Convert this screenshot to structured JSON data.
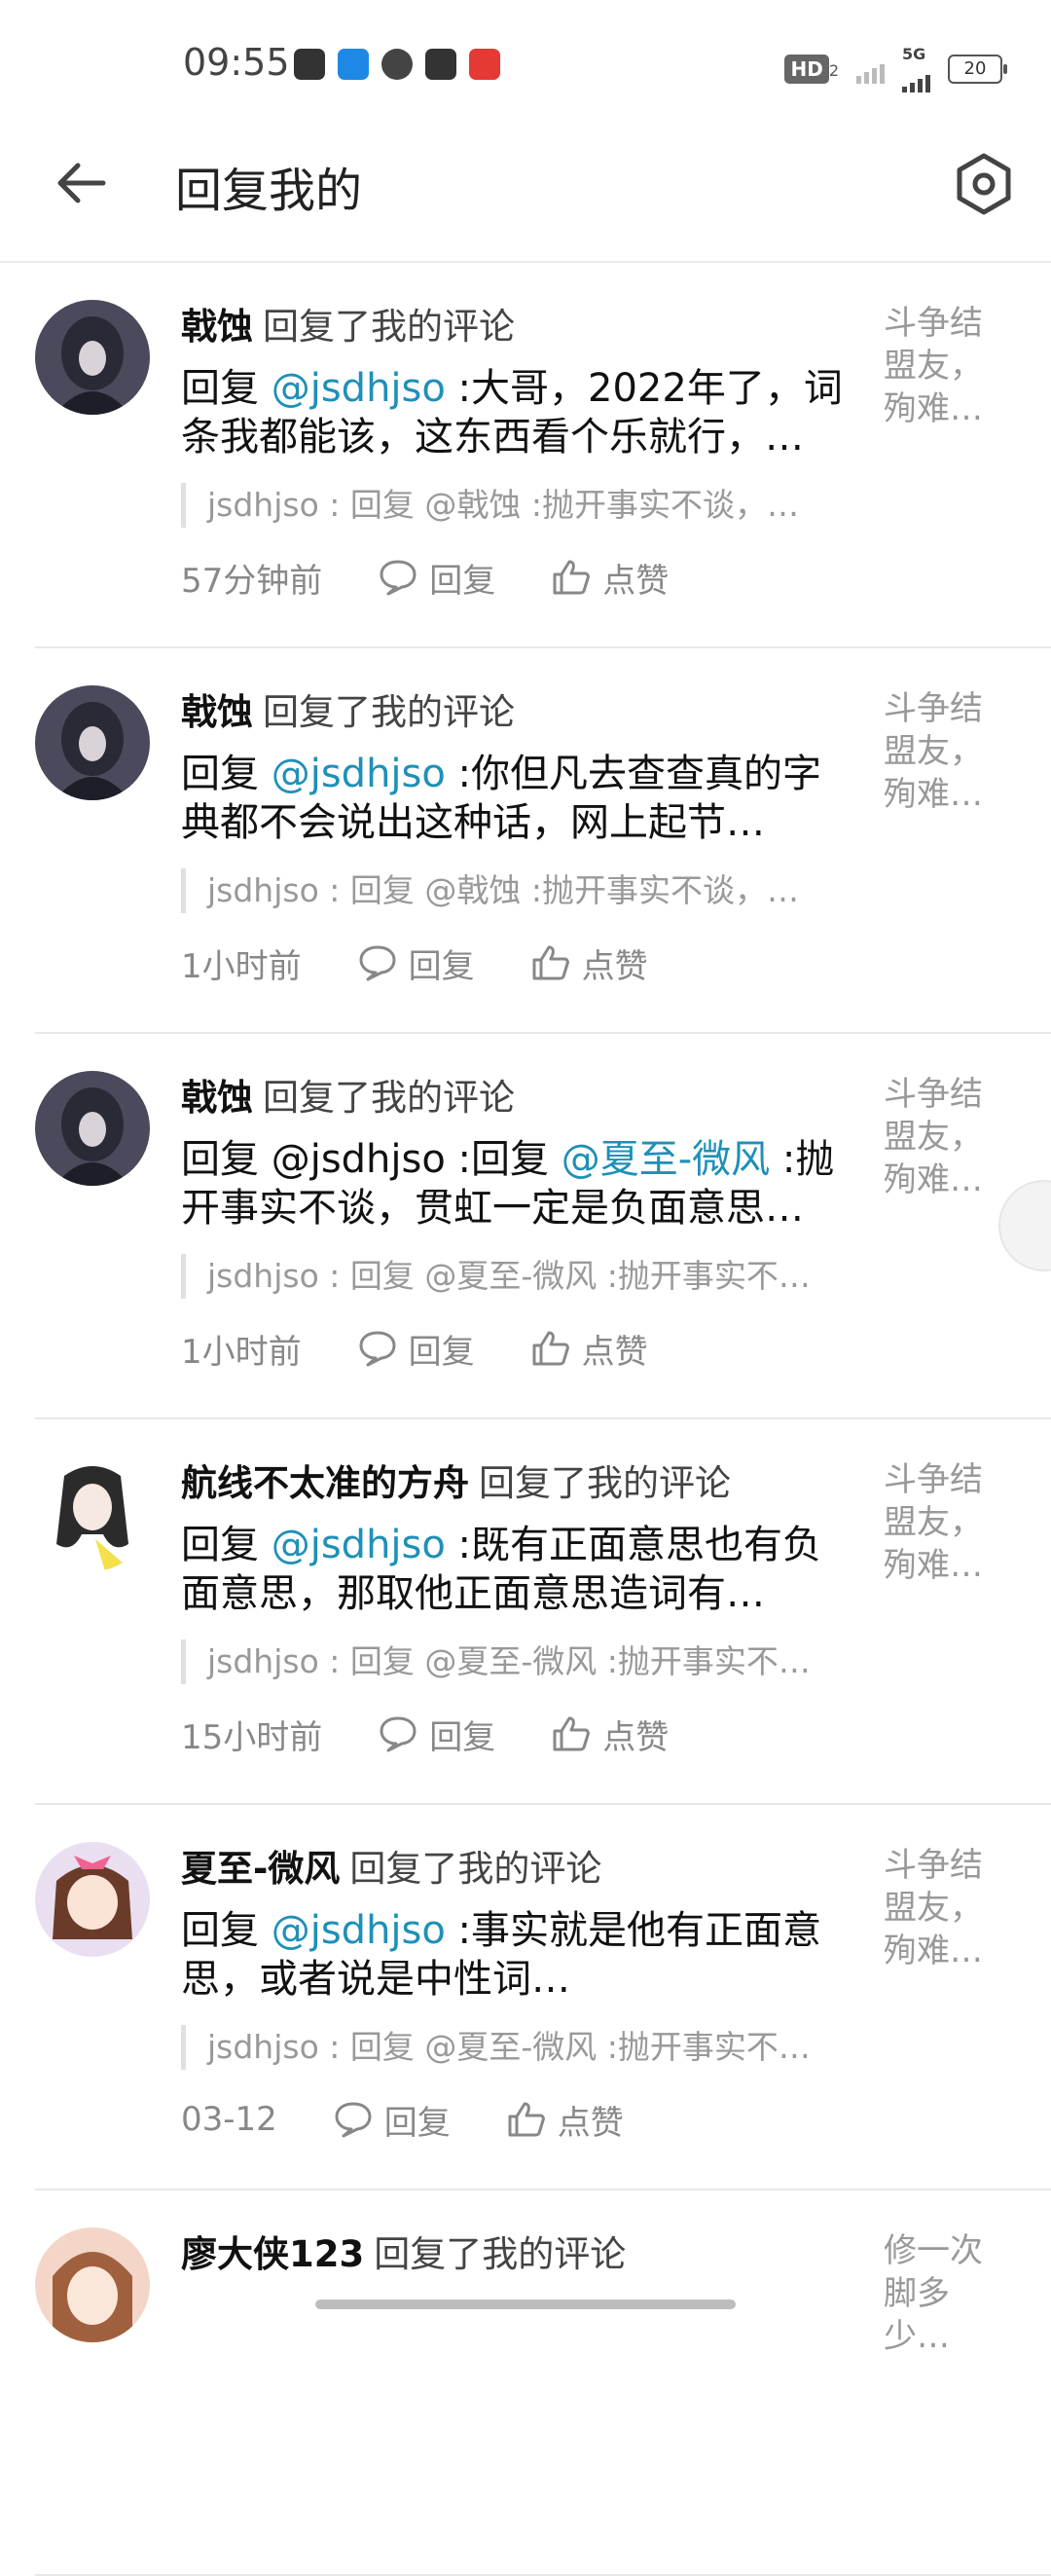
{
  "status_bar": {
    "time": "09:55",
    "hd_label": "HD",
    "sub": "2",
    "net": "5G",
    "battery": "20"
  },
  "header": {
    "title": "回复我的"
  },
  "items": [
    {
      "name": "戟蚀",
      "action": "回复了我的评论",
      "prefix": "回复 ",
      "mentions": [
        "@jsdhjso"
      ],
      "text": " :大哥，2022年了，词条我都能该，这东西看个乐就行，…",
      "quote": "jsdhjso : 回复 @戟蚀 :抛开事实不谈，…",
      "time": "57分钟前",
      "reply": "回复",
      "like": "点赞",
      "side": "斗争结盟友，殉难…"
    },
    {
      "name": "戟蚀",
      "action": "回复了我的评论",
      "prefix": "回复 ",
      "mentions": [
        "@jsdhjso"
      ],
      "text": " :你但凡去查查真的字典都不会说出这种话，网上起节…",
      "quote": "jsdhjso : 回复 @戟蚀 :抛开事实不谈，…",
      "time": "1小时前",
      "reply": "回复",
      "like": "点赞",
      "side": "斗争结盟友，殉难…"
    },
    {
      "name": "戟蚀",
      "action": "回复了我的评论",
      "prefix": "回复 @jsdhjso :回复 ",
      "mentions": [
        "@夏至-微风"
      ],
      "text": " :抛开事实不谈，贯虹一定是负面意思…",
      "quote": "jsdhjso : 回复 @夏至-微风 :抛开事实不…",
      "time": "1小时前",
      "reply": "回复",
      "like": "点赞",
      "side": "斗争结盟友，殉难…"
    },
    {
      "name": "航线不太准的方舟",
      "action": "回复了我的评论",
      "prefix": "回复 ",
      "mentions": [
        "@jsdhjso"
      ],
      "text": " :既有正面意思也有负面意思，那取他正面意思造词有…",
      "quote": "jsdhjso : 回复 @夏至-微风 :抛开事实不…",
      "time": "15小时前",
      "reply": "回复",
      "like": "点赞",
      "side": "斗争结盟友，殉难…"
    },
    {
      "name": "夏至-微风",
      "action": "回复了我的评论",
      "prefix": "回复 ",
      "mentions": [
        "@jsdhjso"
      ],
      "text": " :事实就是他有正面意思，或者说是中性词…",
      "quote": "jsdhjso : 回复 @夏至-微风 :抛开事实不…",
      "time": "03-12",
      "reply": "回复",
      "like": "点赞",
      "side": "斗争结盟友，殉难…"
    },
    {
      "name": "廖大侠123",
      "action": "回复了我的评论",
      "prefix": "",
      "mentions": [],
      "text": "",
      "quote": "",
      "time": "",
      "reply": "",
      "like": "",
      "side": "修一次脚多少…"
    }
  ],
  "colors": {
    "mention": "#1e90b8",
    "accent": "#1e90b8"
  },
  "icons": [
    "back-arrow-icon",
    "settings-hexagon-icon",
    "comment-icon",
    "thumb-up-icon"
  ]
}
